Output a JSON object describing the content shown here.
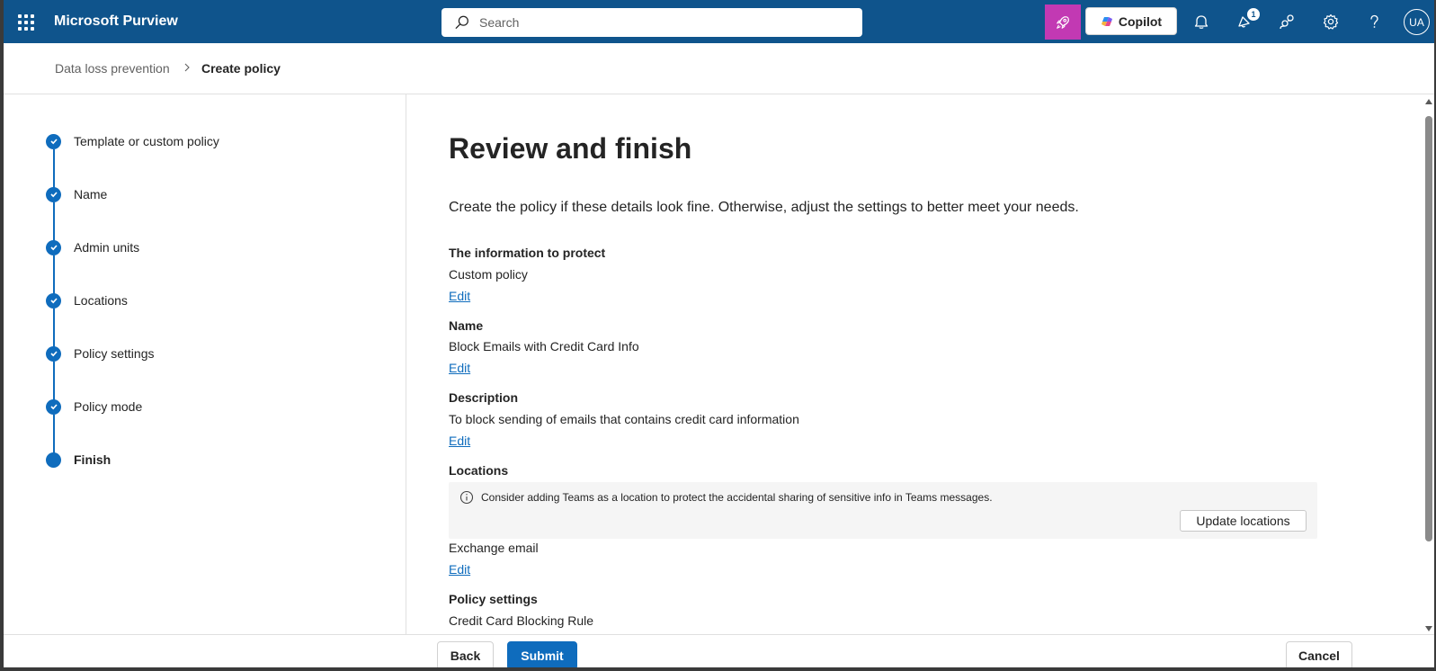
{
  "topbar": {
    "app_name": "Microsoft Purview",
    "search_placeholder": "Search",
    "copilot_label": "Copilot",
    "notification_badge": "1",
    "avatar_initials": "UA"
  },
  "breadcrumb": {
    "parent": "Data loss prevention",
    "current": "Create policy"
  },
  "steps": [
    {
      "label": "Template or custom policy",
      "status": "complete"
    },
    {
      "label": "Name",
      "status": "complete"
    },
    {
      "label": "Admin units",
      "status": "complete"
    },
    {
      "label": "Locations",
      "status": "complete"
    },
    {
      "label": "Policy settings",
      "status": "complete"
    },
    {
      "label": "Policy mode",
      "status": "complete"
    },
    {
      "label": "Finish",
      "status": "current"
    }
  ],
  "main": {
    "title": "Review and finish",
    "intro": "Create the policy if these details look fine. Otherwise, adjust the settings to better meet your needs.",
    "sections": [
      {
        "heading": "The information to protect",
        "value": "Custom policy",
        "edit_label": "Edit"
      },
      {
        "heading": "Name",
        "value": "Block Emails with Credit Card Info",
        "edit_label": "Edit"
      },
      {
        "heading": "Description",
        "value": "To block sending of emails that contains credit card information",
        "edit_label": "Edit"
      },
      {
        "heading": "Locations",
        "value": "Exchange email",
        "edit_label": "Edit"
      },
      {
        "heading": "Policy settings",
        "value": "Credit Card Blocking Rule"
      }
    ],
    "locations_info": {
      "message": "Consider adding Teams as a location to protect the accidental sharing of sensitive info in Teams messages.",
      "button_label": "Update locations"
    }
  },
  "footer": {
    "back_label": "Back",
    "submit_label": "Submit",
    "cancel_label": "Cancel"
  },
  "colors": {
    "topbar": "#0f548c",
    "accent": "#0f6cbd",
    "copilot_rocket": "#c239b3"
  }
}
